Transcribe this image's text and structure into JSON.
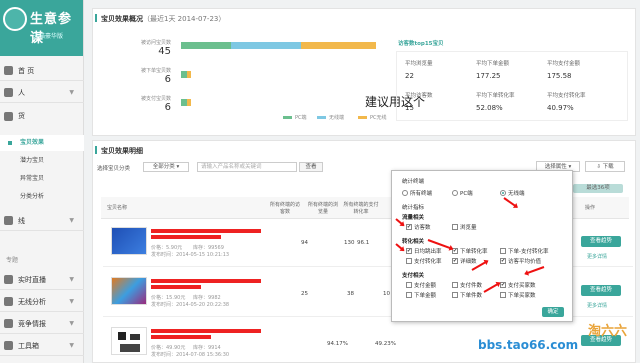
{
  "brand": {
    "title": "生意参谋",
    "subtitle": "天猫豪华版"
  },
  "sidebar": {
    "items": [
      {
        "label": "首 页"
      },
      {
        "label": "人"
      },
      {
        "label": "货"
      },
      {
        "label": "线"
      }
    ],
    "subitems": [
      {
        "label": "宝贝效果",
        "active": true
      },
      {
        "label": "潜力宝贝",
        "active": false
      },
      {
        "label": "异常宝贝",
        "active": false
      },
      {
        "label": "分类分析",
        "active": false
      }
    ],
    "section_label": "专题",
    "lower": [
      {
        "label": "实时直播"
      },
      {
        "label": "无线分析"
      },
      {
        "label": "竞争情报"
      },
      {
        "label": "工具箱"
      }
    ]
  },
  "overview": {
    "title": "宝贝效果概况",
    "date": "（最近1天 2014-07-23）",
    "funnel": [
      {
        "label": "被访问宝贝数",
        "value": "45"
      },
      {
        "label": "被下单宝贝数",
        "value": "6"
      },
      {
        "label": "被支付宝贝数",
        "value": "6"
      }
    ],
    "legend": [
      "PC端",
      "无线端",
      "PC无线"
    ],
    "watermark_text": "建议用这个",
    "top_link": "访客数top15宝贝",
    "stats": [
      {
        "label": "平均浏览量",
        "value": "22"
      },
      {
        "label": "平均下单金额",
        "value": "177.25"
      },
      {
        "label": "平均支付金额",
        "value": "175.58"
      },
      {
        "label": "平均访客数",
        "value": "15"
      },
      {
        "label": "平均下单转化率",
        "value": "52.08%"
      },
      {
        "label": "平均支付转化率",
        "value": "40.97%"
      }
    ],
    "colors": {
      "pc": "#6bbf8e",
      "wireless": "#7ec8e3",
      "pcwireless": "#f2b84b",
      "accent": "#3aa69b"
    }
  },
  "detail": {
    "title": "宝贝效果明细",
    "category_label": "选择宝贝分类",
    "category_select": "全部分类",
    "search_placeholder": "请输入产品名称或关键词",
    "search_button": "查看",
    "attr_button": "选择属性",
    "download_button": "下载",
    "select_badge": "最选36项",
    "columns": [
      "宝贝名称",
      "所有终端的访客数",
      "所有终端的浏览量",
      "所有终端的支付转化率",
      "操作"
    ],
    "rows": [
      {
        "price": "价格：5.90元",
        "stock": "库存：99569",
        "date": "发布时间：2014-05-15 10:21:13",
        "visitors": "94",
        "views": "130",
        "rate": "96.1",
        "action": "查看趋势",
        "more": "更多详情"
      },
      {
        "price": "价格：15.90元",
        "stock": "库存：9982",
        "date": "发布时间：2014-05-20 20:22:38",
        "visitors": "25",
        "views": "38",
        "rate": "10",
        "action": "查看趋势",
        "more": "更多详情"
      },
      {
        "price": "价格：49.90元",
        "stock": "库存：9914",
        "date": "发布时间：2014-07-08 15:36:30",
        "visitors": "94.17%",
        "views": "49.23%",
        "rate": "",
        "action": "查看趋势",
        "more": ""
      }
    ]
  },
  "popup": {
    "terminal_label": "统计终端",
    "terminals": [
      {
        "label": "所有终端",
        "on": false
      },
      {
        "label": "PC端",
        "on": false
      },
      {
        "label": "无线端",
        "on": true
      }
    ],
    "metrics_label": "统计指标",
    "groups": [
      {
        "title": "流量相关",
        "items": [
          {
            "label": "访客数",
            "on": true
          },
          {
            "label": "浏览量",
            "on": false
          }
        ]
      },
      {
        "title": "转化相关",
        "items": [
          {
            "label": "日均跳出率",
            "on": true
          },
          {
            "label": "下单转化率",
            "on": true
          },
          {
            "label": "下单-支付转化率",
            "on": false
          },
          {
            "label": "支付转化率",
            "on": false
          },
          {
            "label": "详细数",
            "on": true
          },
          {
            "label": "访客平均价值",
            "on": true
          }
        ]
      },
      {
        "title": "支付相关",
        "items": [
          {
            "label": "支付金额",
            "on": false
          },
          {
            "label": "支付件数",
            "on": false
          },
          {
            "label": "支付买家数",
            "on": true
          },
          {
            "label": "下单金额",
            "on": false
          },
          {
            "label": "下单件数",
            "on": false
          },
          {
            "label": "下单买家数",
            "on": false
          }
        ]
      }
    ],
    "confirm": "确定"
  },
  "watermarks": {
    "url": "bbs.tao66.com",
    "logo": "淘六六"
  }
}
